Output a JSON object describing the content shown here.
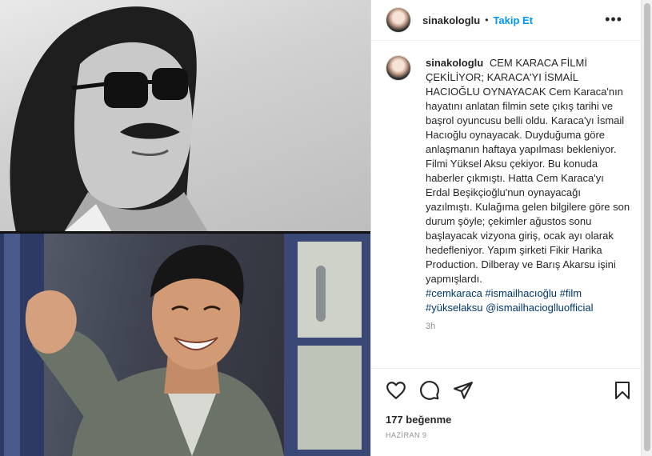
{
  "post": {
    "username": "sinakologlu",
    "separator": "•",
    "follow_label": "Takip Et",
    "more_label": "•••",
    "caption_user": "sinakologlu",
    "caption_text": "CEM KARACA FİLMİ ÇEKİLİYOR; KARACA'YI İSMAİL HACIOĞLU OYNAYACAK Cem Karaca'nın hayatını anlatan filmin sete çıkış tarihi ve başrol oyuncusu belli oldu. Karaca'yı İsmail Hacıoğlu oynayacak. Duyduğuma göre anlaşmanın haftaya yapılması bekleniyor. Filmi Yüksel Aksu çekiyor. Bu konuda haberler çıkmıştı. Hatta Cem Karaca'yı Erdal Beşikçioğlu'nun oynayacağı yazılmıştı. Kulağıma gelen bilgilere göre son durum şöyle; çekimler ağustos sonu başlayacak vizyona giriş, ocak ayı olarak hedefleniyor. Yapım şirketi Fikir Harika Production. Dilberay ve Barış Akarsu işini yapmışlardı.",
    "hashtags": "#cemkaraca #ismailhacıoğlu #film #yükselaksu @ismailhacioglluofficial",
    "time_ago": "3h",
    "likes": "177 beğenme",
    "date": "HAZİRAN 9"
  },
  "icons": {
    "like": "heart-icon",
    "comment": "comment-icon",
    "share": "share-icon",
    "save": "bookmark-icon"
  },
  "colors": {
    "link": "#0095f6",
    "hashtag": "#00376b",
    "meta": "#8e8e8e"
  }
}
